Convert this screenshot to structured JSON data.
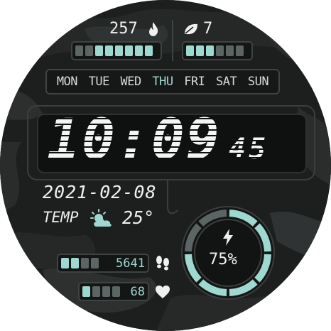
{
  "colors": {
    "accent": "#9ed8d0",
    "text": "#f0f0f0",
    "inactive": "#5b6563",
    "background": "#1c1d1d"
  },
  "calories": {
    "value": "257",
    "icon": "flame-icon",
    "level_fraction": 0.75
  },
  "floors": {
    "value": "7",
    "icon": "leaf-icon",
    "level_fraction": 0.5
  },
  "weekdays": {
    "items": [
      "MON",
      "TUE",
      "WED",
      "THU",
      "FRI",
      "SAT",
      "SUN"
    ],
    "active": "THU"
  },
  "time": {
    "hours_minutes": "10:09",
    "seconds": "45"
  },
  "date": "2021-02-08",
  "weather": {
    "label": "TEMP",
    "icon": "partly-cloudy-icon",
    "temperature": "25°"
  },
  "battery": {
    "icon": "lightning-bolt-icon",
    "percent_label": "75%",
    "level_fraction": 0.75
  },
  "steps": {
    "value": "5641",
    "icon": "footsteps-icon",
    "level_fraction": 0.5
  },
  "heart_rate": {
    "value": "68",
    "icon": "heart-icon",
    "level_fraction": 0.25
  }
}
